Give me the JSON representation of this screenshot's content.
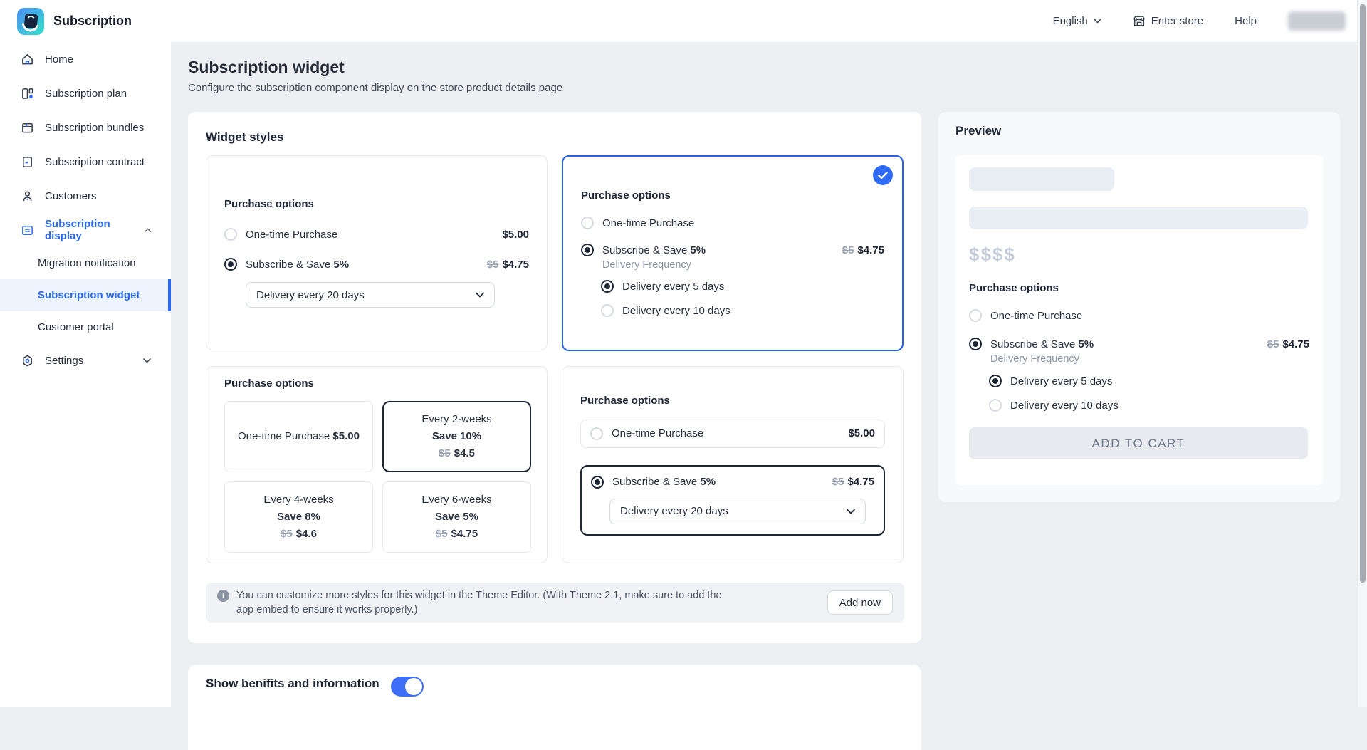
{
  "topbar": {
    "app_title": "Subscription",
    "language": "English",
    "enter_store_label": "Enter store",
    "help_label": "Help"
  },
  "sidebar": {
    "items": [
      {
        "label": "Home"
      },
      {
        "label": "Subscription plan"
      },
      {
        "label": "Subscription bundles"
      },
      {
        "label": "Subscription contract"
      },
      {
        "label": "Customers"
      },
      {
        "label": "Subscription display"
      },
      {
        "label": "Migration notification"
      },
      {
        "label": "Subscription widget"
      },
      {
        "label": "Customer portal"
      },
      {
        "label": "Settings"
      }
    ]
  },
  "page": {
    "title": "Subscription widget",
    "subtitle": "Configure the subscription component display on the store product details page"
  },
  "widget_styles": {
    "section_title": "Widget styles",
    "labels": {
      "purchase_options": "Purchase options",
      "one_time": "One-time Purchase",
      "subscribe_save": "Subscribe & Save",
      "discount": "5%",
      "full_price": "$5.00",
      "old_price": "$5",
      "new_price": "$4.75",
      "delivery_select": "Delivery every 20 days",
      "delivery_frequency": "Delivery Frequency",
      "delivery_5": "Delivery every 5 days",
      "delivery_10": "Delivery every 10 days"
    },
    "style3": {
      "one_time_label": "One-time Purchase",
      "one_time_price": "$5.00",
      "plans": [
        {
          "title": "Every 2-weeks",
          "save": "Save 10%",
          "old_price": "$5",
          "new_price": "$4.5"
        },
        {
          "title": "Every 4-weeks",
          "save": "Save 8%",
          "old_price": "$5",
          "new_price": "$4.6"
        },
        {
          "title": "Every 6-weeks",
          "save": "Save 5%",
          "old_price": "$5",
          "new_price": "$4.75"
        }
      ]
    },
    "note": {
      "text": "You can customize more styles for this widget in the Theme Editor. (With Theme 2.1, make sure to add the app embed to ensure it works properly.)",
      "button": "Add now"
    }
  },
  "benefits": {
    "label": "Show benifits and information",
    "state": "on"
  },
  "preview": {
    "title": "Preview",
    "price_placeholder": "$$$$",
    "purchase_options": "Purchase options",
    "one_time": "One-time Purchase",
    "subscribe_save": "Subscribe & Save",
    "discount": "5%",
    "old_price": "$5",
    "new_price": "$4.75",
    "delivery_frequency": "Delivery Frequency",
    "delivery_5": "Delivery every 5 days",
    "delivery_10": "Delivery every 10 days",
    "add_to_cart": "ADD TO CART"
  },
  "colors": {
    "accent_blue": "#2c69f5",
    "selected_card_border": "#2563eb",
    "selected_box_border": "#1d2736",
    "toggle_on": "#3e6ef5"
  }
}
